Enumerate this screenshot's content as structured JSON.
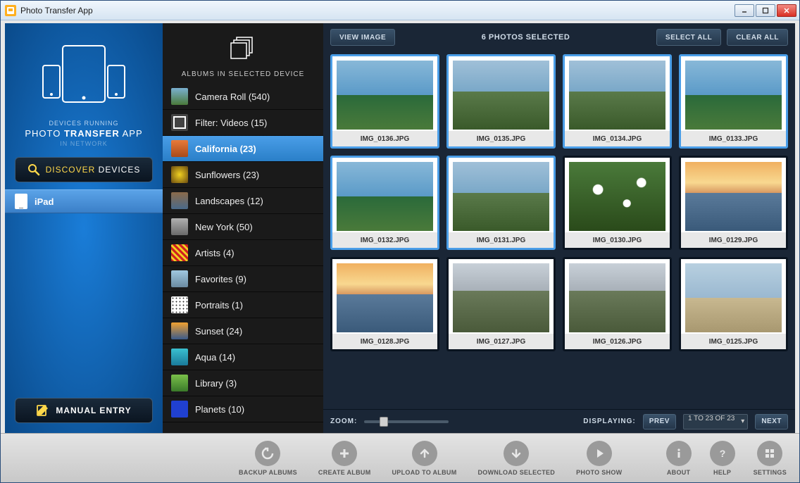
{
  "window": {
    "title": "Photo Transfer App"
  },
  "left": {
    "devices_running_label": "DEVICES RUNNING",
    "app_name_html": "PHOTO TRANSFER APP",
    "app_name_prefix": "PHOTO ",
    "app_name_bold": "TRANSFER",
    "app_name_suffix": " APP",
    "in_network": "IN NETWORK",
    "discover_prefix": "DISCOVER",
    "discover_suffix": " DEVICES",
    "manual_entry": "MANUAL ENTRY",
    "devices": [
      {
        "name": "iPad"
      }
    ]
  },
  "albums": {
    "header": "ALBUMS IN SELECTED DEVICE",
    "items": [
      {
        "label": "Camera Roll (540)",
        "thumb": "at1"
      },
      {
        "label": "Filter: Videos (15)",
        "thumb": "at2"
      },
      {
        "label": "California (23)",
        "thumb": "at3",
        "active": true
      },
      {
        "label": "Sunflowers (23)",
        "thumb": "at4"
      },
      {
        "label": "Landscapes (12)",
        "thumb": "at5"
      },
      {
        "label": "New York (50)",
        "thumb": "at6"
      },
      {
        "label": "Artists (4)",
        "thumb": "at7"
      },
      {
        "label": "Favorites (9)",
        "thumb": "at8"
      },
      {
        "label": "Portraits (1)",
        "thumb": "at9"
      },
      {
        "label": "Sunset (24)",
        "thumb": "at10"
      },
      {
        "label": "Aqua (14)",
        "thumb": "at11"
      },
      {
        "label": "Library (3)",
        "thumb": "at12"
      },
      {
        "label": "Planets (10)",
        "thumb": "at13"
      }
    ]
  },
  "topbar": {
    "view_image": "VIEW IMAGE",
    "selected_status": "6 PHOTOS SELECTED",
    "select_all": "SELECT ALL",
    "clear_all": "CLEAR ALL"
  },
  "photos": [
    {
      "caption": "IMG_0136.JPG",
      "selected": true,
      "cls": "ph-ocean"
    },
    {
      "caption": "IMG_0135.JPG",
      "selected": true,
      "cls": "ph-coast"
    },
    {
      "caption": "IMG_0134.JPG",
      "selected": true,
      "cls": "ph-coast"
    },
    {
      "caption": "IMG_0133.JPG",
      "selected": true,
      "cls": "ph-ocean"
    },
    {
      "caption": "IMG_0132.JPG",
      "selected": true,
      "cls": "ph-ocean"
    },
    {
      "caption": "IMG_0131.JPG",
      "selected": true,
      "cls": "ph-coast"
    },
    {
      "caption": "IMG_0130.JPG",
      "selected": false,
      "cls": "ph-flowers"
    },
    {
      "caption": "IMG_0129.JPG",
      "selected": false,
      "cls": "ph-sunset"
    },
    {
      "caption": "IMG_0128.JPG",
      "selected": false,
      "cls": "ph-sunset"
    },
    {
      "caption": "IMG_0127.JPG",
      "selected": false,
      "cls": "ph-hills"
    },
    {
      "caption": "IMG_0126.JPG",
      "selected": false,
      "cls": "ph-hills"
    },
    {
      "caption": "IMG_0125.JPG",
      "selected": false,
      "cls": "ph-beach"
    }
  ],
  "botbar": {
    "zoom_label": "ZOOM:",
    "displaying_label": "DISPLAYING:",
    "prev": "PREV",
    "range": "1 TO 23 OF 23",
    "next": "NEXT"
  },
  "toolbar": {
    "backup": "BACKUP ALBUMS",
    "create": "CREATE ALBUM",
    "upload": "UPLOAD TO ALBUM",
    "download": "DOWNLOAD SELECTED",
    "show": "PHOTO SHOW",
    "about": "ABOUT",
    "help": "HELP",
    "settings": "SETTINGS"
  }
}
